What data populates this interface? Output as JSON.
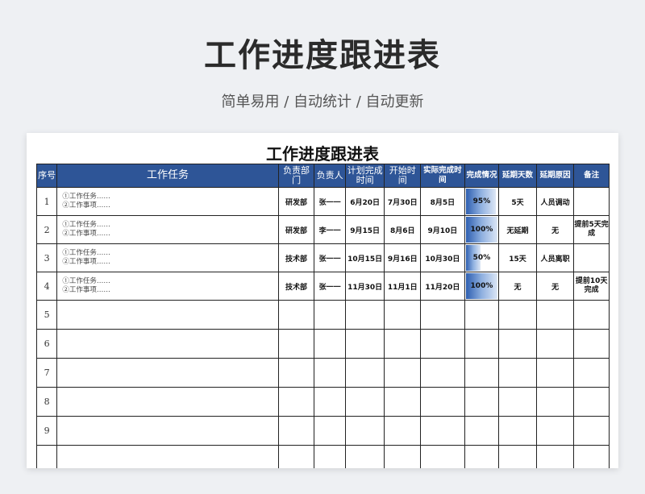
{
  "hero": {
    "title": "工作进度跟进表",
    "subtitle": "简单易用  /  自动统计  /  自动更新"
  },
  "sheet_title": "工作进度跟进表",
  "headers": {
    "no": "序号",
    "task": "工作任务",
    "dept": "负责部门",
    "owner": "负责人",
    "plan": "计划完成时间",
    "start": "开始时间",
    "actual": "实际完成时间",
    "progress": "完成情况",
    "delay_days": "延期天数",
    "delay_reason": "延期原因",
    "note": "备注"
  },
  "rows": [
    {
      "no": "1",
      "task1": "①工作任务……",
      "task2": "②工作事项……",
      "dept": "研发部",
      "owner": "张一一",
      "plan": "6月20日",
      "start": "7月30日",
      "actual": "8月5日",
      "progress": "95%",
      "progress_value": 0.95,
      "delay_days": "5天",
      "delay_reason": "人员调动",
      "note": ""
    },
    {
      "no": "2",
      "task1": "①工作任务……",
      "task2": "②工作事项……",
      "dept": "研发部",
      "owner": "李一一",
      "plan": "9月15日",
      "start": "8月6日",
      "actual": "9月10日",
      "progress": "100%",
      "progress_value": 1.0,
      "delay_days": "无延期",
      "delay_reason": "无",
      "note": "提前5天完成"
    },
    {
      "no": "3",
      "task1": "①工作任务……",
      "task2": "②工作事项……",
      "dept": "技术部",
      "owner": "张一一",
      "plan": "10月15日",
      "start": "9月16日",
      "actual": "10月30日",
      "progress": "50%",
      "progress_value": 0.5,
      "delay_days": "15天",
      "delay_reason": "人员离职",
      "note": ""
    },
    {
      "no": "4",
      "task1": "①工作任务……",
      "task2": "②工作事项……",
      "dept": "技术部",
      "owner": "张一一",
      "plan": "11月30日",
      "start": "11月1日",
      "actual": "11月20日",
      "progress": "100%",
      "progress_value": 1.0,
      "delay_days": "无",
      "delay_reason": "无",
      "note": "提前10天完成"
    }
  ],
  "empty_rows": [
    "5",
    "6",
    "7",
    "8",
    "9",
    ""
  ],
  "colors": {
    "header_bg": "#2e5597",
    "bar_start": "#2e5fb0",
    "bar_end": "#dce6f5"
  }
}
